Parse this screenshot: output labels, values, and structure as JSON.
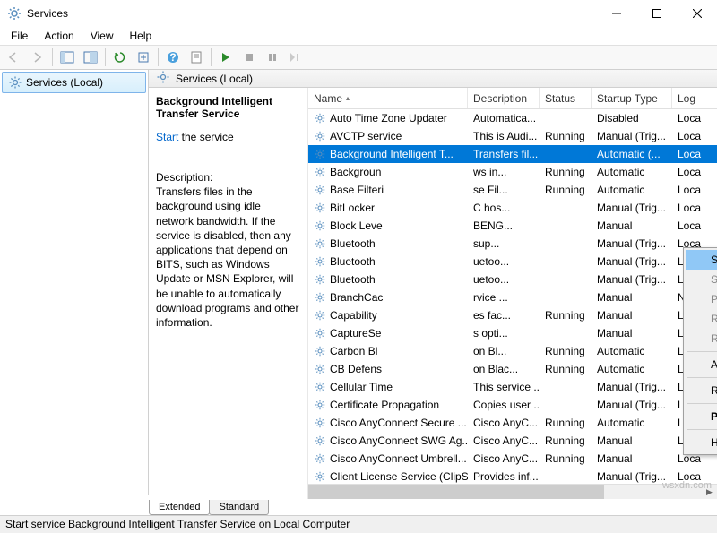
{
  "window": {
    "title": "Services"
  },
  "menu": {
    "file": "File",
    "action": "Action",
    "view": "View",
    "help": "Help"
  },
  "tree": {
    "node": "Services (Local)"
  },
  "listHeader": {
    "title": "Services (Local)"
  },
  "detail": {
    "title": "Background Intelligent Transfer Service",
    "linkPrefix": "Start",
    "linkSuffix": " the service",
    "descLabel": "Description:",
    "descText": "Transfers files in the background using idle network bandwidth. If the service is disabled, then any applications that depend on BITS, such as Windows Update or MSN Explorer, will be unable to automatically download programs and other information."
  },
  "columns": {
    "name": "Name",
    "desc": "Description",
    "status": "Status",
    "startup": "Startup Type",
    "logon": "Log"
  },
  "rows": [
    {
      "name": "Auto Time Zone Updater",
      "desc": "Automatica...",
      "status": "",
      "startup": "Disabled",
      "logon": "Loca"
    },
    {
      "name": "AVCTP service",
      "desc": "This is Audi...",
      "status": "Running",
      "startup": "Manual (Trig...",
      "logon": "Loca"
    },
    {
      "name": "Background Intelligent T...",
      "desc": "Transfers fil...",
      "status": "",
      "startup": "Automatic (...",
      "logon": "Loca",
      "selected": true
    },
    {
      "name": "Backgroun",
      "desc": "ws in...",
      "status": "Running",
      "startup": "Automatic",
      "logon": "Loca"
    },
    {
      "name": "Base Filteri",
      "desc": "se Fil...",
      "status": "Running",
      "startup": "Automatic",
      "logon": "Loca"
    },
    {
      "name": "BitLocker",
      "desc": "C hos...",
      "status": "",
      "startup": "Manual (Trig...",
      "logon": "Loca"
    },
    {
      "name": "Block Leve",
      "desc": "BENG...",
      "status": "",
      "startup": "Manual",
      "logon": "Loca"
    },
    {
      "name": "Bluetooth",
      "desc": "sup...",
      "status": "",
      "startup": "Manual (Trig...",
      "logon": "Loca"
    },
    {
      "name": "Bluetooth",
      "desc": "uetoo...",
      "status": "",
      "startup": "Manual (Trig...",
      "logon": "Loca"
    },
    {
      "name": "Bluetooth",
      "desc": "uetoo...",
      "status": "",
      "startup": "Manual (Trig...",
      "logon": "Loca"
    },
    {
      "name": "BranchCac",
      "desc": "rvice ...",
      "status": "",
      "startup": "Manual",
      "logon": "Netw"
    },
    {
      "name": "Capability",
      "desc": "es fac...",
      "status": "Running",
      "startup": "Manual",
      "logon": "Loca"
    },
    {
      "name": "CaptureSe",
      "desc": "s opti...",
      "status": "",
      "startup": "Manual",
      "logon": "Loca"
    },
    {
      "name": "Carbon Bl",
      "desc": "on Bl...",
      "status": "Running",
      "startup": "Automatic",
      "logon": "Loca"
    },
    {
      "name": "CB Defens",
      "desc": "on Blac...",
      "status": "Running",
      "startup": "Automatic",
      "logon": "Loca"
    },
    {
      "name": "Cellular Time",
      "desc": "This service ...",
      "status": "",
      "startup": "Manual (Trig...",
      "logon": "Loca"
    },
    {
      "name": "Certificate Propagation",
      "desc": "Copies user ...",
      "status": "",
      "startup": "Manual (Trig...",
      "logon": "Loca"
    },
    {
      "name": "Cisco AnyConnect Secure ...",
      "desc": "Cisco AnyC...",
      "status": "Running",
      "startup": "Automatic",
      "logon": "Loca"
    },
    {
      "name": "Cisco AnyConnect SWG Ag...",
      "desc": "Cisco AnyC...",
      "status": "Running",
      "startup": "Manual",
      "logon": "Loca"
    },
    {
      "name": "Cisco AnyConnect Umbrell...",
      "desc": "Cisco AnyC...",
      "status": "Running",
      "startup": "Manual",
      "logon": "Loca"
    },
    {
      "name": "Client License Service (ClipS...",
      "desc": "Provides inf...",
      "status": "",
      "startup": "Manual (Trig...",
      "logon": "Loca"
    }
  ],
  "contextMenu": {
    "start": "Start",
    "stop": "Stop",
    "pause": "Pause",
    "resume": "Resume",
    "restart": "Restart",
    "allTasks": "All Tasks",
    "refresh": "Refresh",
    "properties": "Properties",
    "help": "Help"
  },
  "tabs": {
    "extended": "Extended",
    "standard": "Standard"
  },
  "statusbar": "Start service Background Intelligent Transfer Service on Local Computer",
  "watermark": "wsxdn.com"
}
